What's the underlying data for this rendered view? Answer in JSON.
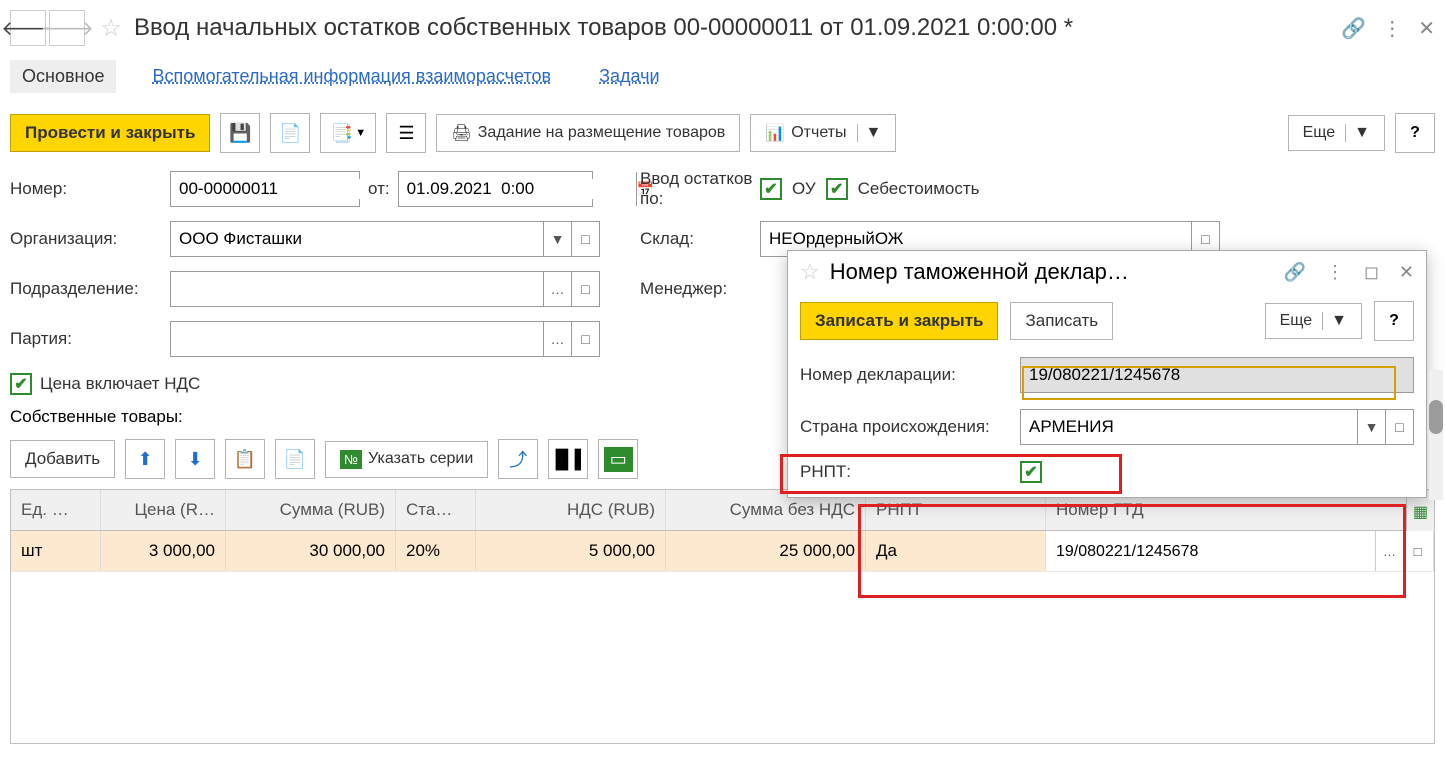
{
  "title": "Ввод начальных остатков собственных товаров 00-00000011 от 01.09.2021 0:00:00 *",
  "tabs": {
    "main": "Основное",
    "aux": "Вспомогательная информация взаиморасчетов",
    "tasks": "Задачи"
  },
  "toolbar": {
    "postClose": "Провести и закрыть",
    "placement": "Задание на размещение товаров",
    "reports": "Отчеты",
    "more": "Еще"
  },
  "fields": {
    "numberLbl": "Номер:",
    "numberVal": "00-00000011",
    "fromLbl": "от:",
    "fromVal": "01.09.2021  0:00",
    "orgLbl": "Организация:",
    "orgVal": "ООО Фисташки",
    "deptLbl": "Подразделение:",
    "deptVal": "",
    "partyLbl": "Партия:",
    "partyVal": "",
    "balanceLbl": "Ввод остатков по:",
    "ouLbl": "ОУ",
    "costLbl": "Себестоимость",
    "warehouseLbl": "Склад:",
    "warehouseVal": "НЕОрдерныйОЖ",
    "managerLbl": "Менеджер:",
    "managerVal": "",
    "priceIncVatLbl": "Цена включает НДС"
  },
  "ownGoodsLbl": "Собственные товары:",
  "tableToolbar": {
    "add": "Добавить",
    "series": "Указать серии"
  },
  "tableHeaders": {
    "unit": "Ед. …",
    "price": "Цена (R…",
    "sum": "Сумма (RUB)",
    "rate": "Ста…",
    "vat": "НДС (RUB)",
    "noVat": "Сумма без НДС",
    "rnpt": "РНПТ",
    "gtd": "Номер ГТД"
  },
  "tableRow": {
    "unit": "шт",
    "price": "3 000,00",
    "sum": "30 000,00",
    "rate": "20%",
    "vat": "5 000,00",
    "noVat": "25 000,00",
    "rnpt": "Да",
    "gtd": "19/080221/1245678"
  },
  "popup": {
    "title": "Номер таможенной деклар…",
    "writeClose": "Записать и закрыть",
    "write": "Записать",
    "more": "Еще",
    "declNoLbl": "Номер декларации:",
    "declNoVal": "19/080221/1245678",
    "countryLbl": "Страна происхождения:",
    "countryVal": "АРМЕНИЯ",
    "rnptLbl": "РНПТ:"
  }
}
